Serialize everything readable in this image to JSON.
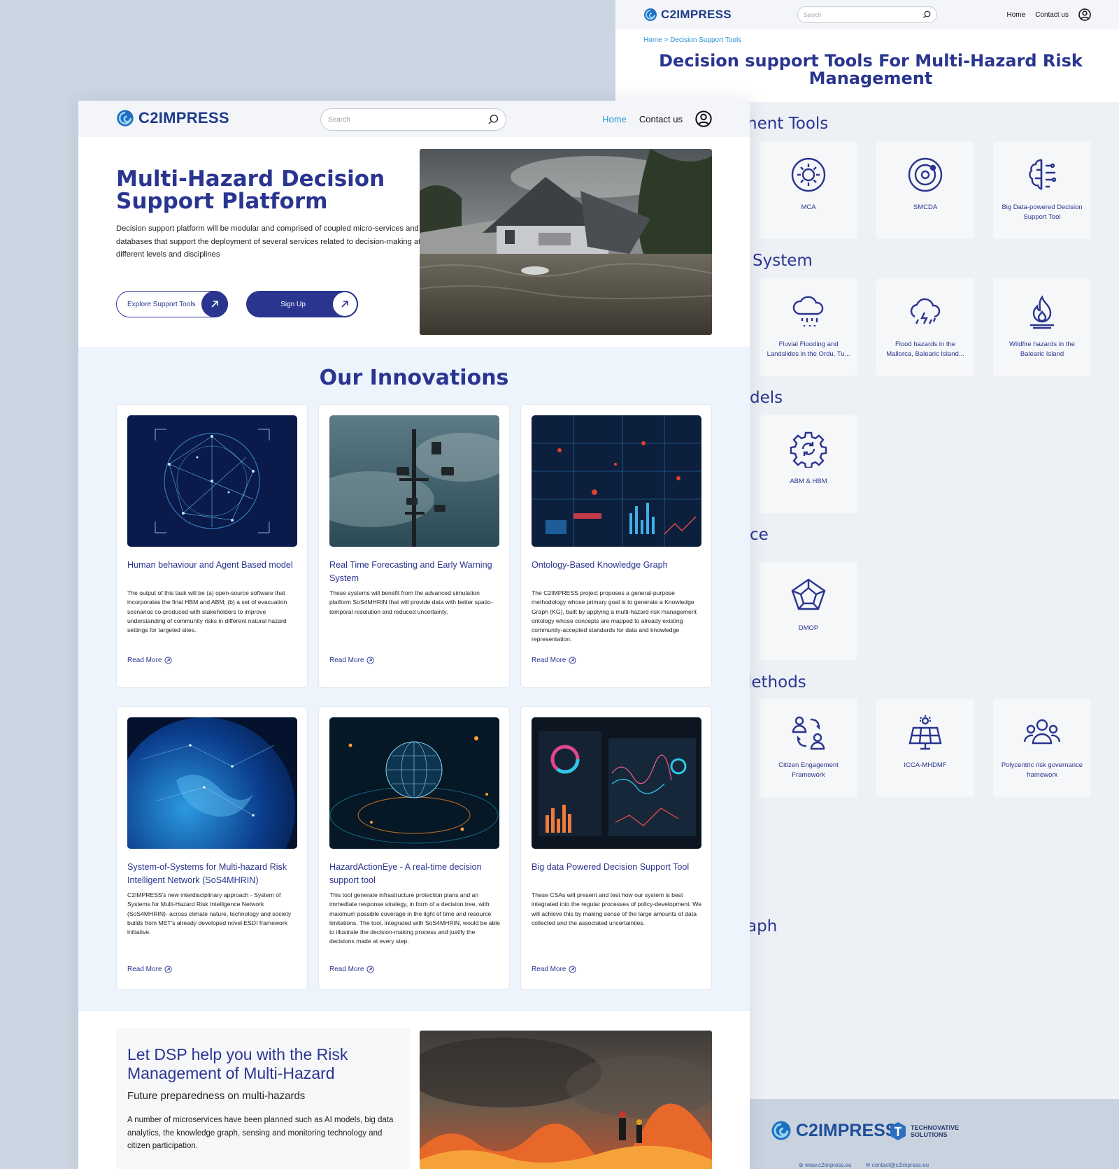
{
  "back": {
    "logo_text": "C2IMPRESS",
    "search_placeholder": "Search",
    "nav": {
      "home": "Home",
      "contact": "Contact us"
    },
    "breadcrumb": "Home > Decision Support Tools",
    "title": "Decision support Tools For Multi-Hazard Risk Management",
    "sections": [
      {
        "heading": "nent Tools"
      },
      {
        "heading": "System"
      },
      {
        "heading": "dels"
      },
      {
        "heading": "ce"
      },
      {
        "heading": "lethods"
      },
      {
        "heading": "aph"
      }
    ],
    "tools": [
      {
        "label": "MCA",
        "icon": "gear-circle-icon"
      },
      {
        "label": "SMCDA",
        "icon": "orbit-icon"
      },
      {
        "label": "Big Data-powered Decision Support Tool",
        "icon": "brain-icon"
      },
      {
        "label": "Fluvial Flooding and Landslides in the Ordu, Tu...",
        "icon": "rain-cloud-icon"
      },
      {
        "label": "Flood hazards in the Mallorca, Balearic Island...",
        "icon": "storm-cloud-icon"
      },
      {
        "label": "Wildfire hazards in the Balearic Island",
        "icon": "fire-icon"
      },
      {
        "label": "ABM & HBM",
        "icon": "gear-sync-icon"
      },
      {
        "label": "DMOP",
        "icon": "pentagon-icon"
      },
      {
        "label": "Citizen Engagement Framework",
        "icon": "people-exchange-icon"
      },
      {
        "label": "ICCA-MHDMF",
        "icon": "solar-panel-icon"
      },
      {
        "label": "Polycentric risk governance framework",
        "icon": "group-icon"
      }
    ],
    "footer": {
      "logo_text": "C2IMPRESS",
      "partner_line1": "TECHNOVATIVE",
      "partner_line2": "SOLUTIONS",
      "website": "www.c2impress.eu",
      "email": "contact@c2impress.eu"
    }
  },
  "front": {
    "logo_text": "C2IMPRESS",
    "search_placeholder": "Search",
    "nav": {
      "home": "Home",
      "contact": "Contact us"
    },
    "hero": {
      "title": "Multi-Hazard Decision Support Platform",
      "description": "Decision support platform will be modular and comprised of coupled micro-services and databases that support the deployment of several services related to decision-making at different levels and disciplines",
      "explore_button": "Explore Support Tools",
      "signup_button": "Sign Up"
    },
    "innovations": {
      "heading": "Our Innovations",
      "read_more": "Read More",
      "cards": [
        {
          "title": "Human behaviour and Agent Based model",
          "description": "The output of this task will be (a) open-source software that incorporates the final HBM and ABM; (b) a set of evacuation scenarios co-produced  with stakeholders to improve understanding of community risks in different natural hazard settings for targeted sites."
        },
        {
          "title": "Real Time Forecasting and Early Warning System",
          "description": "These systems will benefit from the advanced simulation platform SoS4MHRIN that will provide  data with better spatio-temporal resolution and reduced  uncertainty."
        },
        {
          "title": "Ontology-Based Knowledge Graph",
          "description": "The C2IMPRESS project proposes a general-purpose methodology whose primary goal is to generate a Knowledge Graph (KG), built by applying a multi-hazard risk management ontology whose concepts are mapped to already existing community-accepted standards for  data and knowledge representation."
        },
        {
          "title": "System-of-Systems for Multi-hazard Risk Intelligent Network (SoS4MHRIN)",
          "description": "C2IMPRESS's new interdisciplinary approach - System of Systems for Multi-Hazard Risk Intelligence Network (SoS4MHRIN)- across climate nature, technology and society builds from MET's already developed novel  ESDI framework initiative."
        },
        {
          "title": "HazardActionEye - A real-time decision support tool",
          "description": "This tool generate infrastructure protection plans and an immediate response strategy, in form of a decision tree, with maximum possible coverage in the light of time and resource limitations. The tool, integrated with SoS4MHRIN, would be able to illustrate the decision-making process and justify  the decisions made at every step."
        },
        {
          "title": "Big data Powered Decision Support Tool",
          "description": "These CSAs will present and test how our system is best integrated into the regular processes of policy-development. We will achieve this by making sense of the large amounts of data collected and the associated uncertainties."
        }
      ]
    },
    "dsp": {
      "title": "Let DSP help you with the Risk Management of Multi-Hazard",
      "subtitle": "Future preparedness on multi-hazards",
      "description": "A number of microservices have been planned such as AI models, big data analytics, the knowledge graph, sensing and monitoring technology and citizen participation."
    }
  }
}
